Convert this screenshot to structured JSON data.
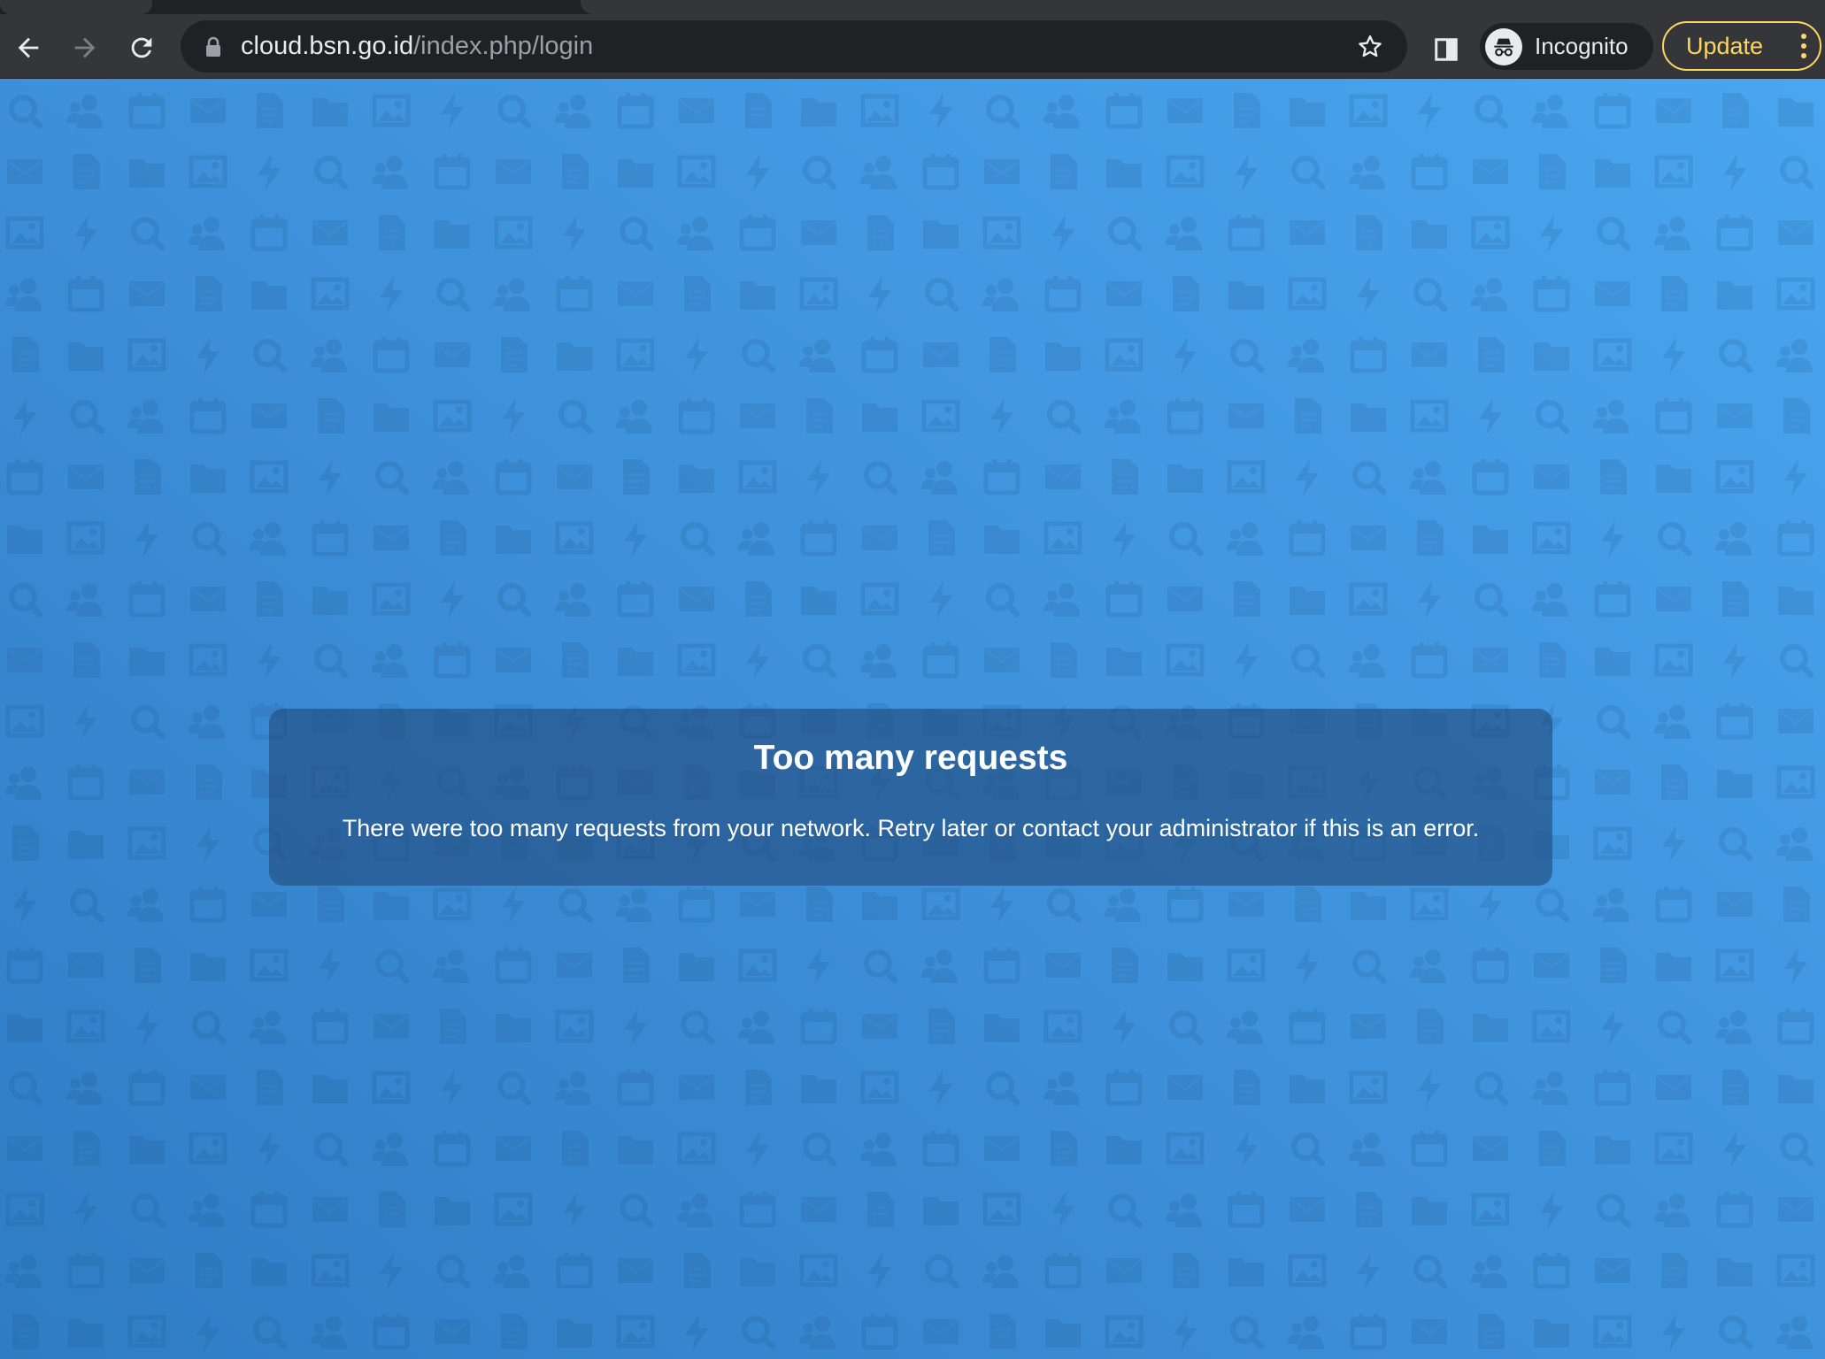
{
  "browser": {
    "url_host": "cloud.bsn.go.id",
    "url_path": "/index.php/login",
    "profile_label": "Incognito",
    "update_label": "Update",
    "accent_color": "#fdd663"
  },
  "page": {
    "heading": "Too many requests",
    "message": "There were too many requests from your network. Retry later or contact your administrator if this is an error.",
    "background_colors": [
      "#2f7cc4",
      "#4aa6ef"
    ],
    "pattern_icons": [
      "search-icon",
      "contacts-icon",
      "calendar-icon",
      "mail-icon",
      "document-icon",
      "folder-icon",
      "image-icon",
      "activity-icon"
    ]
  }
}
